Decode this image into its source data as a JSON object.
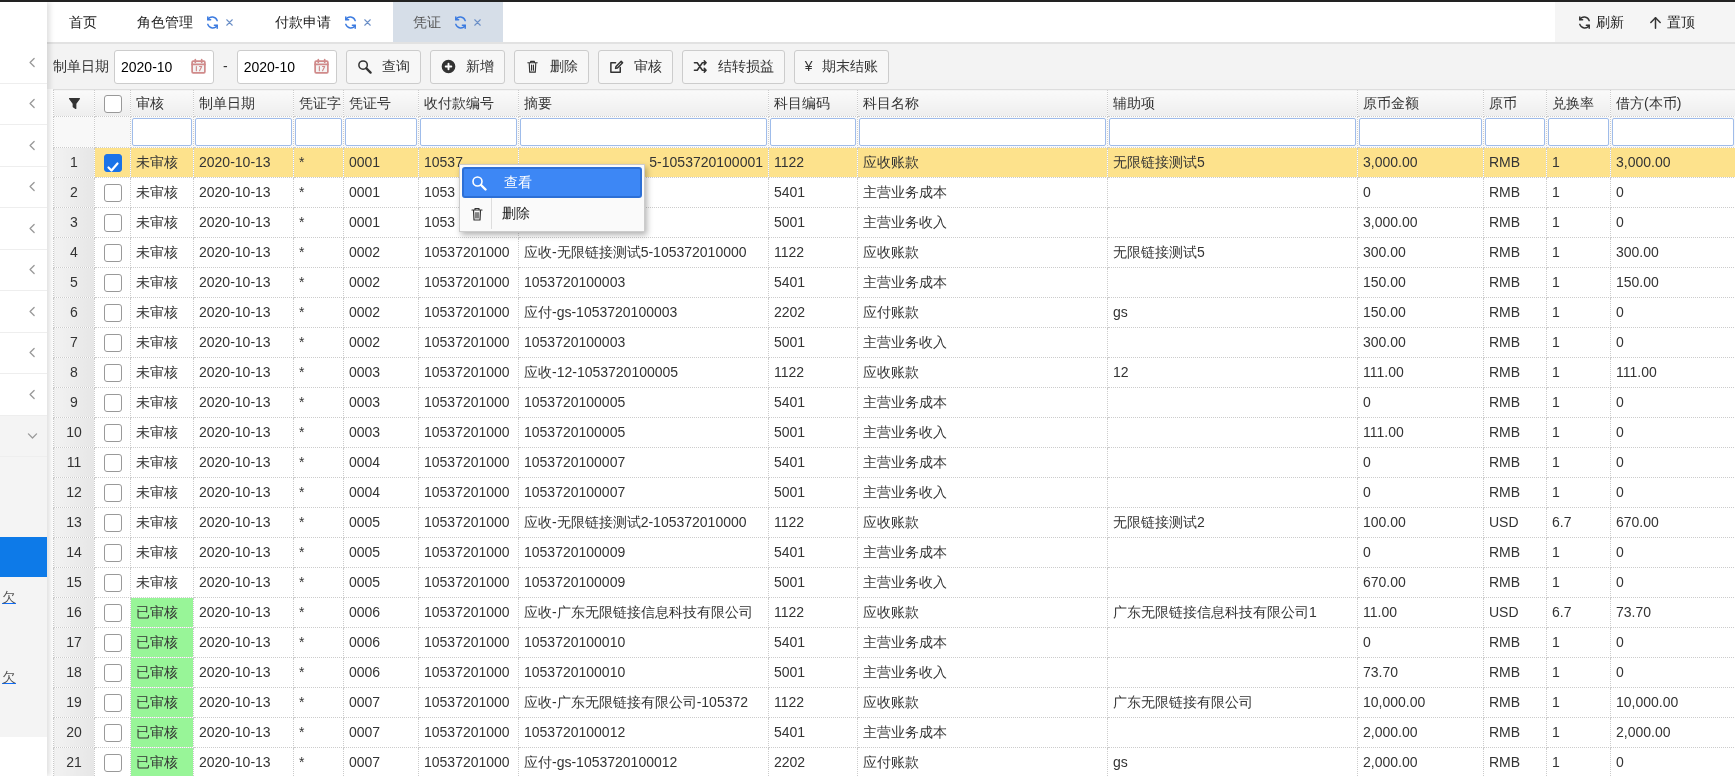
{
  "sidebar": {
    "items": [
      {
        "expanded": false
      },
      {
        "expanded": false
      },
      {
        "expanded": false
      },
      {
        "expanded": false
      },
      {
        "expanded": false
      },
      {
        "expanded": false
      },
      {
        "expanded": false
      },
      {
        "expanded": false
      },
      {
        "expanded": false
      },
      {
        "expanded": true,
        "children": [
          {
            "selected": false
          },
          {
            "selected": false
          },
          {
            "selected": true
          },
          {
            "label": "欠",
            "selected": false
          },
          {
            "selected": false
          },
          {
            "label": "欠",
            "selected": false
          },
          {
            "selected": false
          }
        ]
      }
    ]
  },
  "tabs": [
    {
      "label": "首页",
      "closable": false,
      "selected": false
    },
    {
      "label": "角色管理",
      "closable": true,
      "selected": false
    },
    {
      "label": "付款申请",
      "closable": true,
      "selected": false
    },
    {
      "label": "凭证",
      "closable": true,
      "selected": true
    }
  ],
  "top_actions": [
    {
      "kind": "refresh",
      "label": "刷新"
    },
    {
      "kind": "up",
      "label": "置顶"
    }
  ],
  "toolbar": {
    "date_label": "制单日期",
    "date_from": "2020-10",
    "separator": "-",
    "date_to": "2020-10",
    "buttons": [
      {
        "kind": "search",
        "label": "查询"
      },
      {
        "kind": "add",
        "label": "新增"
      },
      {
        "kind": "delete",
        "label": "删除"
      },
      {
        "kind": "edit",
        "label": "审核"
      },
      {
        "kind": "shuffle",
        "label": "结转损益"
      },
      {
        "kind": "text",
        "icon": "¥",
        "label": "期末结账"
      }
    ]
  },
  "table": {
    "all_checked": false,
    "columns": [
      "审核",
      "制单日期",
      "凭证字",
      "凭证号",
      "收付款编号",
      "摘要",
      "科目编码",
      "科目名称",
      "辅助项",
      "原币金额",
      "原币",
      "兑换率",
      "借方(本币)"
    ],
    "rows": [
      {
        "n": "1",
        "checked": true,
        "selected": true,
        "audited": false,
        "summary_covered": true,
        "cells": [
          "未审核",
          "2020-10-13",
          "*",
          "0001",
          "10537",
          "5-1053720100001",
          "1122",
          "应收账款",
          "无限链接测试5",
          "3,000.00",
          "RMB",
          "1",
          "3,000.00"
        ]
      },
      {
        "n": "2",
        "checked": false,
        "selected": false,
        "audited": false,
        "cells": [
          "未审核",
          "2020-10-13",
          "*",
          "0001",
          "1053",
          null,
          "5401",
          "主营业务成本",
          null,
          "0",
          "RMB",
          "1",
          "0"
        ]
      },
      {
        "n": "3",
        "checked": false,
        "selected": false,
        "audited": false,
        "cells": [
          "未审核",
          "2020-10-13",
          "*",
          "0001",
          "1053",
          null,
          "5001",
          "主营业务收入",
          null,
          "3,000.00",
          "RMB",
          "1",
          "0"
        ]
      },
      {
        "n": "4",
        "checked": false,
        "selected": false,
        "audited": false,
        "cells": [
          "未审核",
          "2020-10-13",
          "*",
          "0002",
          "10537201000",
          "应收-无限链接测试5-105372010000",
          "1122",
          "应收账款",
          "无限链接测试5",
          "300.00",
          "RMB",
          "1",
          "300.00"
        ]
      },
      {
        "n": "5",
        "checked": false,
        "selected": false,
        "audited": false,
        "cells": [
          "未审核",
          "2020-10-13",
          "*",
          "0002",
          "10537201000",
          "1053720100003",
          "5401",
          "主营业务成本",
          null,
          "150.00",
          "RMB",
          "1",
          "150.00"
        ]
      },
      {
        "n": "6",
        "checked": false,
        "selected": false,
        "audited": false,
        "cells": [
          "未审核",
          "2020-10-13",
          "*",
          "0002",
          "10537201000",
          "应付-gs-1053720100003",
          "2202",
          "应付账款",
          "gs",
          "150.00",
          "RMB",
          "1",
          "0"
        ]
      },
      {
        "n": "7",
        "checked": false,
        "selected": false,
        "audited": false,
        "cells": [
          "未审核",
          "2020-10-13",
          "*",
          "0002",
          "10537201000",
          "1053720100003",
          "5001",
          "主营业务收入",
          null,
          "300.00",
          "RMB",
          "1",
          "0"
        ]
      },
      {
        "n": "8",
        "checked": false,
        "selected": false,
        "audited": false,
        "cells": [
          "未审核",
          "2020-10-13",
          "*",
          "0003",
          "10537201000",
          "应收-12-1053720100005",
          "1122",
          "应收账款",
          "12",
          "111.00",
          "RMB",
          "1",
          "111.00"
        ]
      },
      {
        "n": "9",
        "checked": false,
        "selected": false,
        "audited": false,
        "cells": [
          "未审核",
          "2020-10-13",
          "*",
          "0003",
          "10537201000",
          "1053720100005",
          "5401",
          "主营业务成本",
          null,
          "0",
          "RMB",
          "1",
          "0"
        ]
      },
      {
        "n": "10",
        "checked": false,
        "selected": false,
        "audited": false,
        "cells": [
          "未审核",
          "2020-10-13",
          "*",
          "0003",
          "10537201000",
          "1053720100005",
          "5001",
          "主营业务收入",
          null,
          "111.00",
          "RMB",
          "1",
          "0"
        ]
      },
      {
        "n": "11",
        "checked": false,
        "selected": false,
        "audited": false,
        "cells": [
          "未审核",
          "2020-10-13",
          "*",
          "0004",
          "10537201000",
          "1053720100007",
          "5401",
          "主营业务成本",
          null,
          "0",
          "RMB",
          "1",
          "0"
        ]
      },
      {
        "n": "12",
        "checked": false,
        "selected": false,
        "audited": false,
        "cells": [
          "未审核",
          "2020-10-13",
          "*",
          "0004",
          "10537201000",
          "1053720100007",
          "5001",
          "主营业务收入",
          null,
          "0",
          "RMB",
          "1",
          "0"
        ]
      },
      {
        "n": "13",
        "checked": false,
        "selected": false,
        "audited": false,
        "cells": [
          "未审核",
          "2020-10-13",
          "*",
          "0005",
          "10537201000",
          "应收-无限链接测试2-105372010000",
          "1122",
          "应收账款",
          "无限链接测试2",
          "100.00",
          "USD",
          "6.7",
          "670.00"
        ]
      },
      {
        "n": "14",
        "checked": false,
        "selected": false,
        "audited": false,
        "cells": [
          "未审核",
          "2020-10-13",
          "*",
          "0005",
          "10537201000",
          "1053720100009",
          "5401",
          "主营业务成本",
          null,
          "0",
          "RMB",
          "1",
          "0"
        ]
      },
      {
        "n": "15",
        "checked": false,
        "selected": false,
        "audited": false,
        "cells": [
          "未审核",
          "2020-10-13",
          "*",
          "0005",
          "10537201000",
          "1053720100009",
          "5001",
          "主营业务收入",
          null,
          "670.00",
          "RMB",
          "1",
          "0"
        ]
      },
      {
        "n": "16",
        "checked": false,
        "selected": false,
        "audited": true,
        "cells": [
          "已审核",
          "2020-10-13",
          "*",
          "0006",
          "10537201000",
          "应收-广东无限链接信息科技有限公司",
          "1122",
          "应收账款",
          "广东无限链接信息科技有限公司1",
          "11.00",
          "USD",
          "6.7",
          "73.70"
        ]
      },
      {
        "n": "17",
        "checked": false,
        "selected": false,
        "audited": true,
        "cells": [
          "已审核",
          "2020-10-13",
          "*",
          "0006",
          "10537201000",
          "1053720100010",
          "5401",
          "主营业务成本",
          null,
          "0",
          "RMB",
          "1",
          "0"
        ]
      },
      {
        "n": "18",
        "checked": false,
        "selected": false,
        "audited": true,
        "cells": [
          "已审核",
          "2020-10-13",
          "*",
          "0006",
          "10537201000",
          "1053720100010",
          "5001",
          "主营业务收入",
          null,
          "73.70",
          "RMB",
          "1",
          "0"
        ]
      },
      {
        "n": "19",
        "checked": false,
        "selected": false,
        "audited": true,
        "cells": [
          "已审核",
          "2020-10-13",
          "*",
          "0007",
          "10537201000",
          "应收-广东无限链接有限公司-105372",
          "1122",
          "应收账款",
          "广东无限链接有限公司",
          "10,000.00",
          "RMB",
          "1",
          "10,000.00"
        ]
      },
      {
        "n": "20",
        "checked": false,
        "selected": false,
        "audited": true,
        "cells": [
          "已审核",
          "2020-10-13",
          "*",
          "0007",
          "10537201000",
          "1053720100012",
          "5401",
          "主营业务成本",
          null,
          "2,000.00",
          "RMB",
          "1",
          "2,000.00"
        ]
      },
      {
        "n": "21",
        "checked": false,
        "selected": false,
        "audited": true,
        "cells": [
          "已审核",
          "2020-10-13",
          "*",
          "0007",
          "10537201000",
          "应付-gs-1053720100012",
          "2202",
          "应付账款",
          "gs",
          "2,000.00",
          "RMB",
          "1",
          "0"
        ]
      }
    ]
  },
  "context_menu": {
    "items": [
      {
        "kind": "search",
        "label": "查看",
        "selected": true
      },
      {
        "kind": "delete",
        "label": "删除",
        "selected": false
      }
    ]
  }
}
